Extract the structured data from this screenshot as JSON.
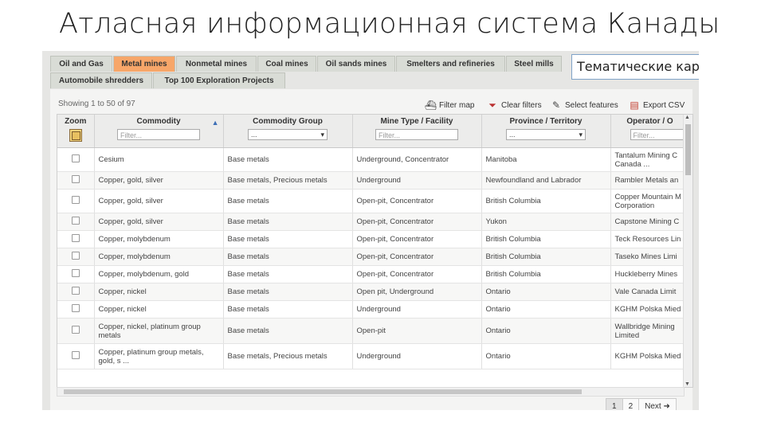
{
  "slide_title": "Атласная информационная система Канады",
  "callout": "Тематические карты",
  "tabs": [
    {
      "label": "Oil and Gas",
      "active": false
    },
    {
      "label": "Metal mines",
      "active": true
    },
    {
      "label": "Nonmetal mines",
      "active": false
    },
    {
      "label": "Coal mines",
      "active": false
    },
    {
      "label": "Oil sands mines",
      "active": false
    },
    {
      "label": "Smelters and refineries",
      "active": false
    },
    {
      "label": "Steel mills",
      "active": false
    },
    {
      "label": "Automobile shredders",
      "active": false
    },
    {
      "label": "Top 100 Exploration Projects",
      "active": false
    }
  ],
  "showing": "Showing 1 to 50 of 97",
  "toolbar": {
    "filter_map": "Filter map",
    "clear_filters": "Clear filters",
    "select_features": "Select features",
    "export_csv": "Export CSV"
  },
  "columns": {
    "zoom": "Zoom",
    "commodity": "Commodity",
    "commodity_filter_placeholder": "Filter...",
    "commodity_group": "Commodity Group",
    "commodity_group_select": "...",
    "mine_type": "Mine Type / Facility",
    "mine_type_filter_placeholder": "Filter...",
    "province": "Province / Territory",
    "province_select": "...",
    "operator": "Operator / O",
    "operator_filter_placeholder": "Filter..."
  },
  "rows": [
    {
      "commodity": "Cesium",
      "group": "Base metals",
      "type": "Underground, Concentrator",
      "province": "Manitoba",
      "operator": "Tantalum Mining C Canada ..."
    },
    {
      "commodity": "Copper, gold, silver",
      "group": "Base metals, Precious metals",
      "type": "Underground",
      "province": "Newfoundland and Labrador",
      "operator": "Rambler Metals an"
    },
    {
      "commodity": "Copper, gold, silver",
      "group": "Base metals",
      "type": "Open-pit, Concentrator",
      "province": "British Columbia",
      "operator": "Copper Mountain M Corporation"
    },
    {
      "commodity": "Copper, gold, silver",
      "group": "Base metals",
      "type": "Open-pit, Concentrator",
      "province": "Yukon",
      "operator": "Capstone Mining C"
    },
    {
      "commodity": "Copper, molybdenum",
      "group": "Base metals",
      "type": "Open-pit, Concentrator",
      "province": "British Columbia",
      "operator": "Teck Resources Lin"
    },
    {
      "commodity": "Copper, molybdenum",
      "group": "Base metals",
      "type": "Open-pit, Concentrator",
      "province": "British Columbia",
      "operator": "Taseko Mines Limi"
    },
    {
      "commodity": "Copper, molybdenum, gold",
      "group": "Base metals",
      "type": "Open-pit, Concentrator",
      "province": "British Columbia",
      "operator": "Huckleberry Mines"
    },
    {
      "commodity": "Copper, nickel",
      "group": "Base metals",
      "type": "Open pit, Underground",
      "province": "Ontario",
      "operator": "Vale Canada Limit"
    },
    {
      "commodity": "Copper, nickel",
      "group": "Base metals",
      "type": "Underground",
      "province": "Ontario",
      "operator": "KGHM Polska Mied"
    },
    {
      "commodity": "Copper, nickel, platinum group metals",
      "group": "Base metals",
      "type": "Open-pit",
      "province": "Ontario",
      "operator": "Wallbridge Mining Limited"
    },
    {
      "commodity": "Copper, platinum group metals, gold, s ...",
      "group": "Base metals, Precious metals",
      "type": "Underground",
      "province": "Ontario",
      "operator": "KGHM Polska Mied"
    }
  ],
  "pagination": {
    "page1": "1",
    "page2": "2",
    "next": "Next ➜"
  }
}
